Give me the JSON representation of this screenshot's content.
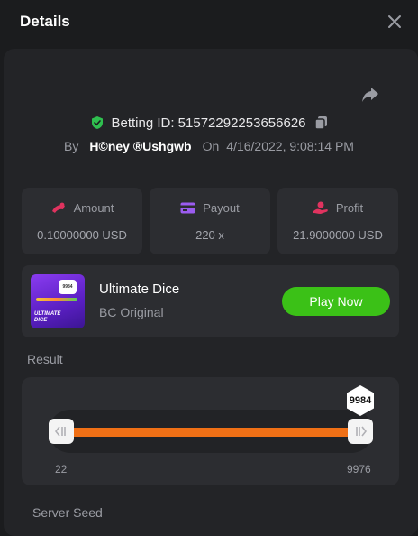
{
  "header": {
    "title": "Details"
  },
  "bet": {
    "id_label": "Betting ID: 51572292253656626",
    "by_label": "By",
    "user": "H©ney ®Ushgwb",
    "on_label": "On",
    "datetime": "4/16/2022, 9:08:14 PM"
  },
  "stats": {
    "amount": {
      "label": "Amount",
      "value": "0.10000000 USD"
    },
    "payout": {
      "label": "Payout",
      "value": "220 x"
    },
    "profit": {
      "label": "Profit",
      "value": "21.9000000 USD"
    }
  },
  "game": {
    "name": "Ultimate Dice",
    "subtitle": "BC Original",
    "play_label": "Play Now",
    "thumb_text": "ULTIMATE\nDICE"
  },
  "result": {
    "label": "Result",
    "value": "9984",
    "range_min": "22",
    "range_max": "9976"
  },
  "server_seed_label": "Server Seed",
  "colors": {
    "accent_green": "#3bc117",
    "accent_orange": "#f07016",
    "amount_icon": "#e0335f",
    "payout_icon": "#9b5cf0",
    "profit_icon": "#e0335f",
    "verified_green": "#2fbf4f"
  },
  "icons": {
    "close": "close-icon",
    "share": "share-icon",
    "verified": "shield-check-icon",
    "copy": "copy-icon",
    "amount": "coins-icon",
    "payout": "card-icon",
    "profit": "hand-coin-icon"
  }
}
